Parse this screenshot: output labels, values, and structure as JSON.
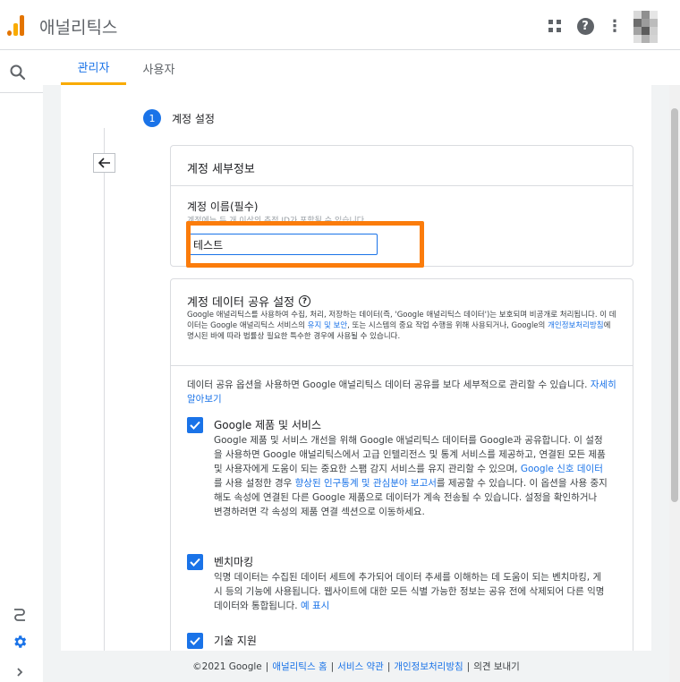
{
  "app": {
    "title": "애널리틱스",
    "accent": "#1a73e8",
    "logo_colors": [
      "#f9ab00",
      "#e37400"
    ]
  },
  "topbar": {
    "icons": [
      "apps-grid-icon",
      "help-icon",
      "more-vert-icon",
      "account-avatar"
    ]
  },
  "tabs": [
    {
      "label": "관리자",
      "active": true
    },
    {
      "label": "사용자",
      "active": false
    }
  ],
  "stepper": {
    "step_number": "1",
    "step_label": "계정 설정"
  },
  "account_details": {
    "title": "계정 세부정보",
    "name_label": "계정 이름(필수)",
    "name_help": "계정에는 두 개 이상의 추적 ID가 포함될 수 있습니다.",
    "name_value": "테스트"
  },
  "data_sharing": {
    "title": "계정 데이터 공유 설정",
    "desc_part1": "Google 애널리틱스를 사용하여 수집, 처리, 저장하는 데이터(즉, 'Google 애널리틱스 데이터')는 보호되며 비공개로 처리됩니다. 이 데이터는 Google 애널리틱스 서비스의 ",
    "desc_link1": "유지 및 보안",
    "desc_part2": ", 또는 시스템의 중요 작업 수행을 위해 사용되거나, Google의 ",
    "desc_link2": "개인정보처리방침",
    "desc_part3": "에 명시된 바에 따라 법률상 필요한 특수한 경우에 사용될 수 있습니다.",
    "intro": "데이터 공유 옵션을 사용하면 Google 애널리틱스 데이터 공유를 보다 세부적으로 관리할 수 있습니다. ",
    "intro_link": "자세히 알아보기",
    "options": [
      {
        "title": "Google 제품 및 서비스",
        "checked": true,
        "desc_part1": "Google 제품 및 서비스 개선을 위해 Google 애널리틱스 데이터를 Google과 공유합니다. 이 설정을 사용하면 Google 애널리틱스에서 고급 인텔리전스 및 통계 서비스를 제공하고, 연결된 모든 제품 및 사용자에게 도움이 되는 중요한 스팸 감지 서비스를 유지 관리할 수 있으며, ",
        "desc_link1": "Google 신호 데이터",
        "desc_part2": "를 사용 설정한 경우 ",
        "desc_link2": "향상된 인구통계 및 관심분야 보고서",
        "desc_part3": "를 제공할 수 있습니다. 이 옵션을 사용 중지해도 속성에 연결된 다른 Google 제품으로 데이터가 계속 전송될 수 있습니다. 설정을 확인하거나 변경하려면 각 속성의 제품 연결 섹션으로 이동하세요."
      },
      {
        "title": "벤치마킹",
        "checked": true,
        "desc": "익명 데이터는 수집된 데이터 세트에 추가되어 데이터 추세를 이해하는 데 도움이 되는 벤치마킹, 게시 등의 기능에 사용됩니다. 웹사이트에 대한 모든 식별 가능한 정보는 공유 전에 삭제되어 다른 익명 데이터와 통합됩니다. ",
        "desc_link": "예 표시"
      },
      {
        "title": "기술 지원",
        "checked": true
      }
    ]
  },
  "footer": {
    "copyright": "©2021 Google",
    "links": [
      "애널리틱스 홈",
      "서비스 약관",
      "개인정보처리방침"
    ],
    "feedback": "의견 보내기"
  }
}
